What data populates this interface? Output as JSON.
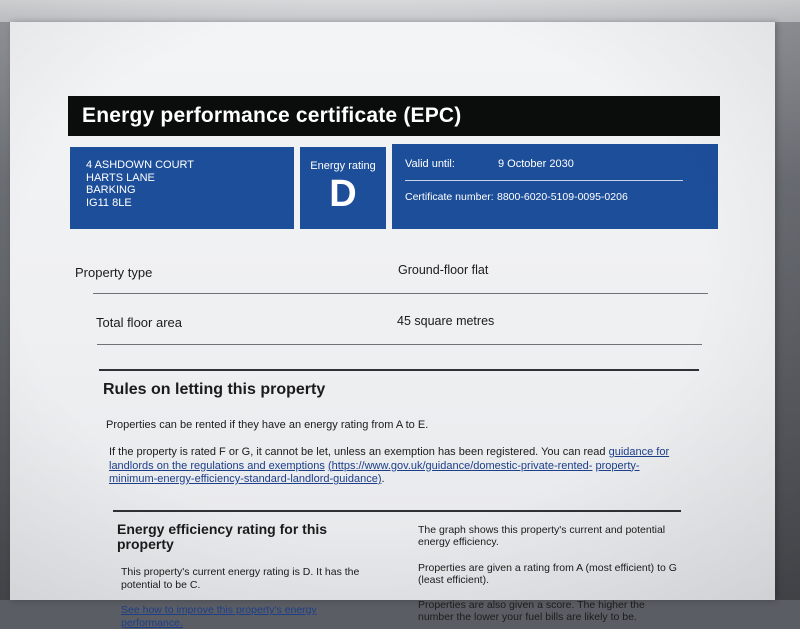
{
  "bezel": {
    "text": ""
  },
  "title": "Energy performance certificate (EPC)",
  "address": {
    "line1": "4 ASHDOWN COURT",
    "line2": "HARTS LANE",
    "line3": "BARKING",
    "line4": "IG11 8LE"
  },
  "rating": {
    "label": "Energy rating",
    "letter": "D"
  },
  "validity": {
    "valid_until_label": "Valid until:",
    "valid_until_value": "9 October 2030",
    "certificate_label": "Certificate number:",
    "certificate_value": "8800-6020-5109-0095-0206"
  },
  "property_type": {
    "label": "Property type",
    "value": "Ground-floor flat"
  },
  "floor_area": {
    "label": "Total floor area",
    "value": "45 square metres"
  },
  "letting": {
    "heading": "Rules on letting this property",
    "para1": "Properties can be rented if they have an energy rating from A to E.",
    "para2_prefix": "If the property is rated F or G, it cannot be let, unless an exemption has been registered. You can read",
    "para2_link": "guidance for landlords on the regulations and exemptions",
    "para2_url_a": "(https://www.gov.uk/guidance/domestic-private-rented-",
    "para2_url_b": "property-minimum-energy-efficiency-standard-landlord-guidance)",
    "para2_suffix": "."
  },
  "efficiency": {
    "heading": "Energy efficiency rating for this property",
    "current_text": "This property's current energy rating is D. It has the potential to be C.",
    "improve_link": "See how to improve this property's energy performance.",
    "graph_text": "The graph shows this property's current and potential energy efficiency.",
    "scale_text": "Properties are given a rating from A (most efficient) to G (least efficient).",
    "score_text": "Properties are also given a score. The higher the number the lower your fuel bills are likely to be."
  }
}
